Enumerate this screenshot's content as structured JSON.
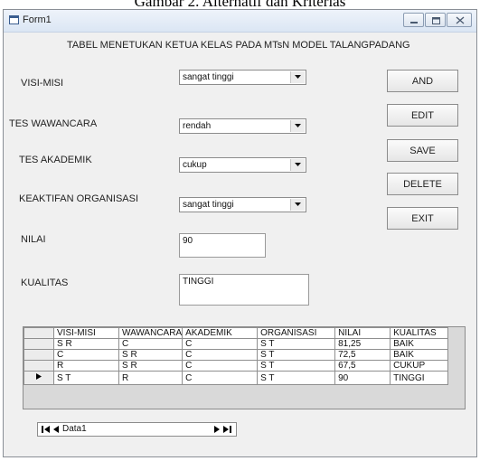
{
  "caption": "Gambar 2. Alternatif dan Kriterias",
  "window": {
    "title": "Form1",
    "minimize_icon": "minimize-icon",
    "maximize_icon": "maximize-icon",
    "close_icon": "close-icon"
  },
  "form": {
    "heading": "TABEL MENETUKAN KETUA KELAS PADA MTsN MODEL TALANGPADANG",
    "fields": {
      "visi_label": "VISI-MISI",
      "visi_value": "sangat tinggi",
      "wawancara_label": "TES WAWANCARA",
      "wawancara_value": "rendah",
      "akademik_label": "TES AKADEMIK",
      "akademik_value": "cukup",
      "organisasi_label": "KEAKTIFAN ORGANISASI",
      "organisasi_value": "sangat tinggi",
      "nilai_label": "NILAI",
      "nilai_value": "90",
      "kualitas_label": "KUALITAS",
      "kualitas_value": "TINGGI"
    },
    "buttons": {
      "and": "AND",
      "edit": "EDIT",
      "save": "SAVE",
      "delete": "DELETE",
      "exit": "EXIT"
    }
  },
  "grid": {
    "columns": [
      "VISI-MISI",
      "WAWANCARA",
      "AKADEMIK",
      "ORGANISASI",
      "NILAI",
      "KUALITAS"
    ],
    "rows": [
      [
        "S R",
        "C",
        "C",
        "S T",
        "81,25",
        "BAIK"
      ],
      [
        "C",
        "S R",
        "C",
        "S T",
        "72,5",
        "BAIK"
      ],
      [
        "R",
        "S R",
        "C",
        "S T",
        "67,5",
        "CUKUP"
      ],
      [
        "S T",
        "R",
        "C",
        "S T",
        "90",
        "TINGGI"
      ]
    ],
    "current_row": 3,
    "row_pointer_icon": "row-pointer-icon"
  },
  "navigator": {
    "caption": "Data1",
    "icons": [
      "first-record-icon",
      "prev-record-icon",
      "next-record-icon",
      "last-record-icon"
    ]
  }
}
